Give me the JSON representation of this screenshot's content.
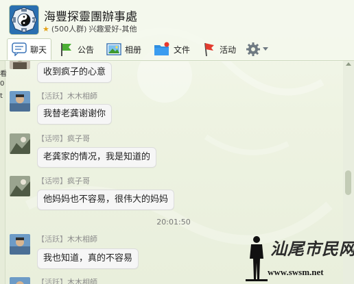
{
  "group": {
    "title": "海豐探靈團辦事處",
    "member_count": "(500人群)",
    "category": "兴趣爱好-其他"
  },
  "tabs": [
    {
      "label": "聊天",
      "icon": "chat-bubble-icon"
    },
    {
      "label": "公告",
      "icon": "announcement-flag-icon"
    },
    {
      "label": "相册",
      "icon": "photo-album-icon"
    },
    {
      "label": "文件",
      "icon": "folder-icon"
    },
    {
      "label": "活动",
      "icon": "event-flag-icon"
    },
    {
      "label": "",
      "icon": "gear-icon"
    }
  ],
  "messages": [
    {
      "rank": "",
      "name": "",
      "text": "收到疯子的心意"
    },
    {
      "rank": "【活跃】",
      "name": "木木相師",
      "text": "我替老龚谢谢你"
    },
    {
      "rank": "【话唠】",
      "name": "疯子哥",
      "text": "老龚家的情况，我是知道的"
    },
    {
      "rank": "【话唠】",
      "name": "疯子哥",
      "text": "他妈妈也不容易，很伟大的妈妈"
    },
    {
      "rank": "【活跃】",
      "name": "木木相師",
      "text": "我也知道，真的不容易"
    },
    {
      "rank": "【活跃】",
      "name": "木木相師",
      "text": ""
    }
  ],
  "timestamp": "20:01:50",
  "left_sliver": [
    "看",
    "0",
    "t"
  ],
  "watermark": {
    "text": "汕尾市民网",
    "url": "www.swsm.net"
  },
  "colors": {
    "background": "#eef3e2",
    "bubble": "#f6f6f6",
    "name": "#8a8a8a",
    "star": "#e3a21a"
  }
}
